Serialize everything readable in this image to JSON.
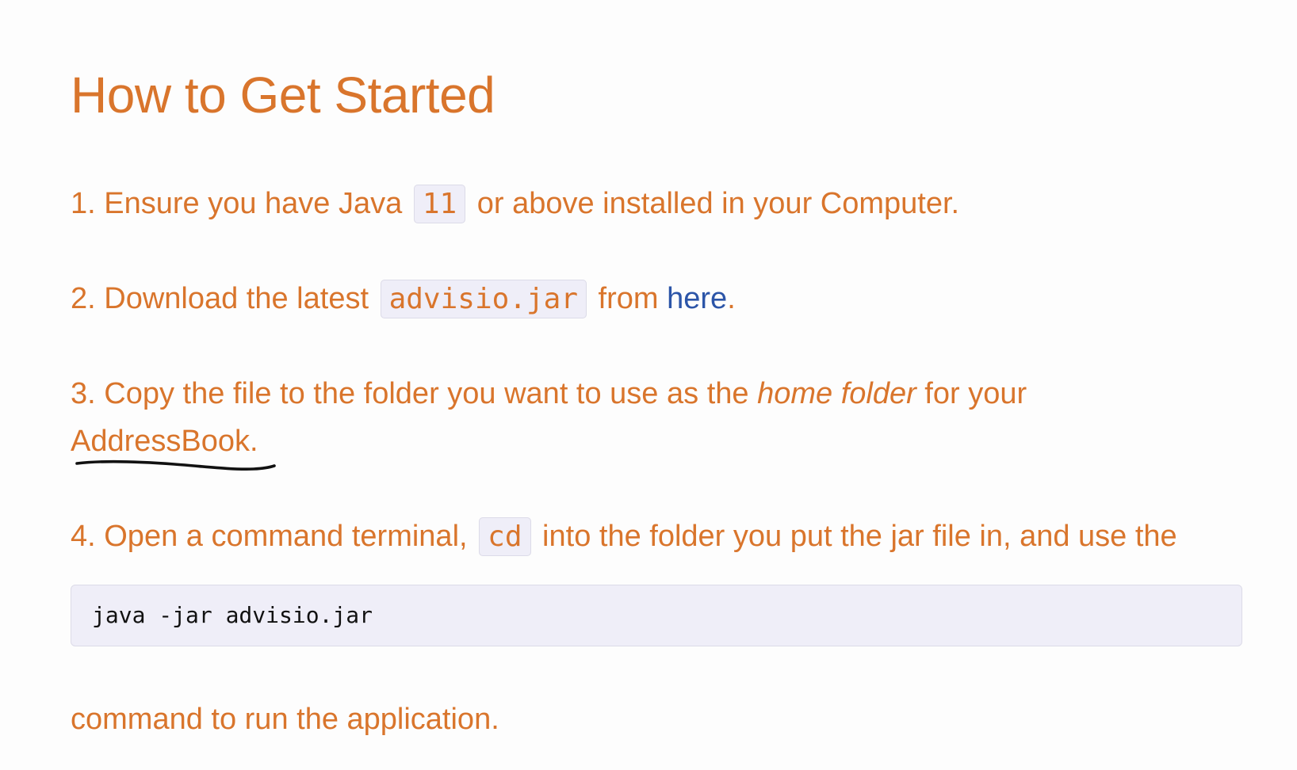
{
  "heading": "How to Get Started",
  "steps": {
    "s1": {
      "before": "1. Ensure you have Java ",
      "code": "11",
      "after": " or above installed in your Computer."
    },
    "s2": {
      "before": "2. Download the latest ",
      "code": "advisio.jar",
      "middle": " from ",
      "link": "here",
      "after": "."
    },
    "s3": {
      "before": "3. Copy the file to the folder you want to use as the ",
      "emphasis": "home folder",
      "after": " for your",
      "line2": "AddressBook."
    },
    "s4": {
      "before": "4. Open a command terminal, ",
      "code": "cd",
      "after": " into the folder you put the jar file in, and use the",
      "command": "java -jar advisio.jar",
      "closing": "command to run the application."
    }
  },
  "colors": {
    "text": "#d9752c",
    "link": "#2c55a8",
    "code_bg": "#efeef8",
    "annotation": "#111111"
  }
}
